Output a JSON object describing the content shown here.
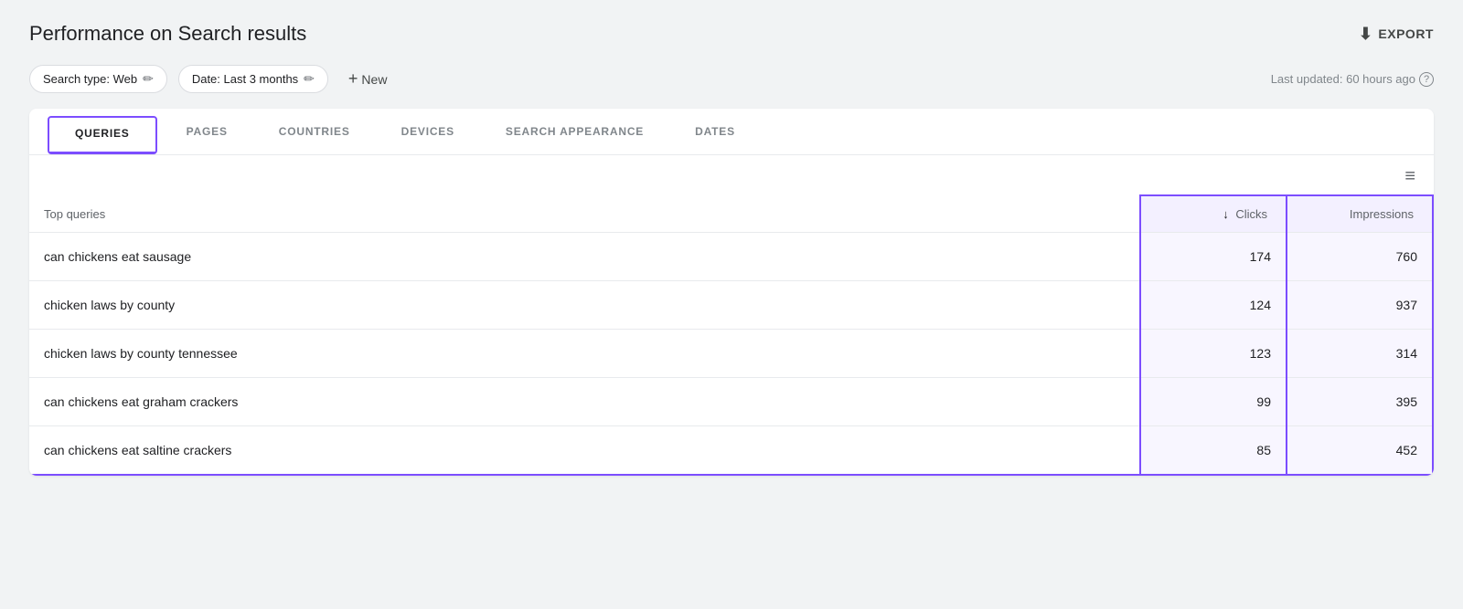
{
  "header": {
    "title": "Performance on Search results",
    "export_label": "EXPORT"
  },
  "filters": {
    "search_type": "Search type: Web",
    "date": "Date: Last 3 months",
    "new_label": "New",
    "last_updated": "Last updated: 60 hours ago"
  },
  "tabs": [
    {
      "id": "queries",
      "label": "QUERIES",
      "active": true
    },
    {
      "id": "pages",
      "label": "PAGES",
      "active": false
    },
    {
      "id": "countries",
      "label": "COUNTRIES",
      "active": false
    },
    {
      "id": "devices",
      "label": "DEVICES",
      "active": false
    },
    {
      "id": "search-appearance",
      "label": "SEARCH APPEARANCE",
      "active": false
    },
    {
      "id": "dates",
      "label": "DATES",
      "active": false
    }
  ],
  "table": {
    "top_queries_label": "Top queries",
    "columns": {
      "query": "",
      "clicks": "Clicks",
      "impressions": "Impressions"
    },
    "rows": [
      {
        "query": "can chickens eat sausage",
        "clicks": "174",
        "impressions": "760"
      },
      {
        "query": "chicken laws by county",
        "clicks": "124",
        "impressions": "937"
      },
      {
        "query": "chicken laws by county tennessee",
        "clicks": "123",
        "impressions": "314"
      },
      {
        "query": "can chickens eat graham crackers",
        "clicks": "99",
        "impressions": "395"
      },
      {
        "query": "can chickens eat saltine crackers",
        "clicks": "85",
        "impressions": "452"
      }
    ]
  },
  "icons": {
    "export": "⬇",
    "edit": "✏",
    "plus": "+",
    "help": "?",
    "filter": "≡",
    "sort_down": "↓"
  }
}
